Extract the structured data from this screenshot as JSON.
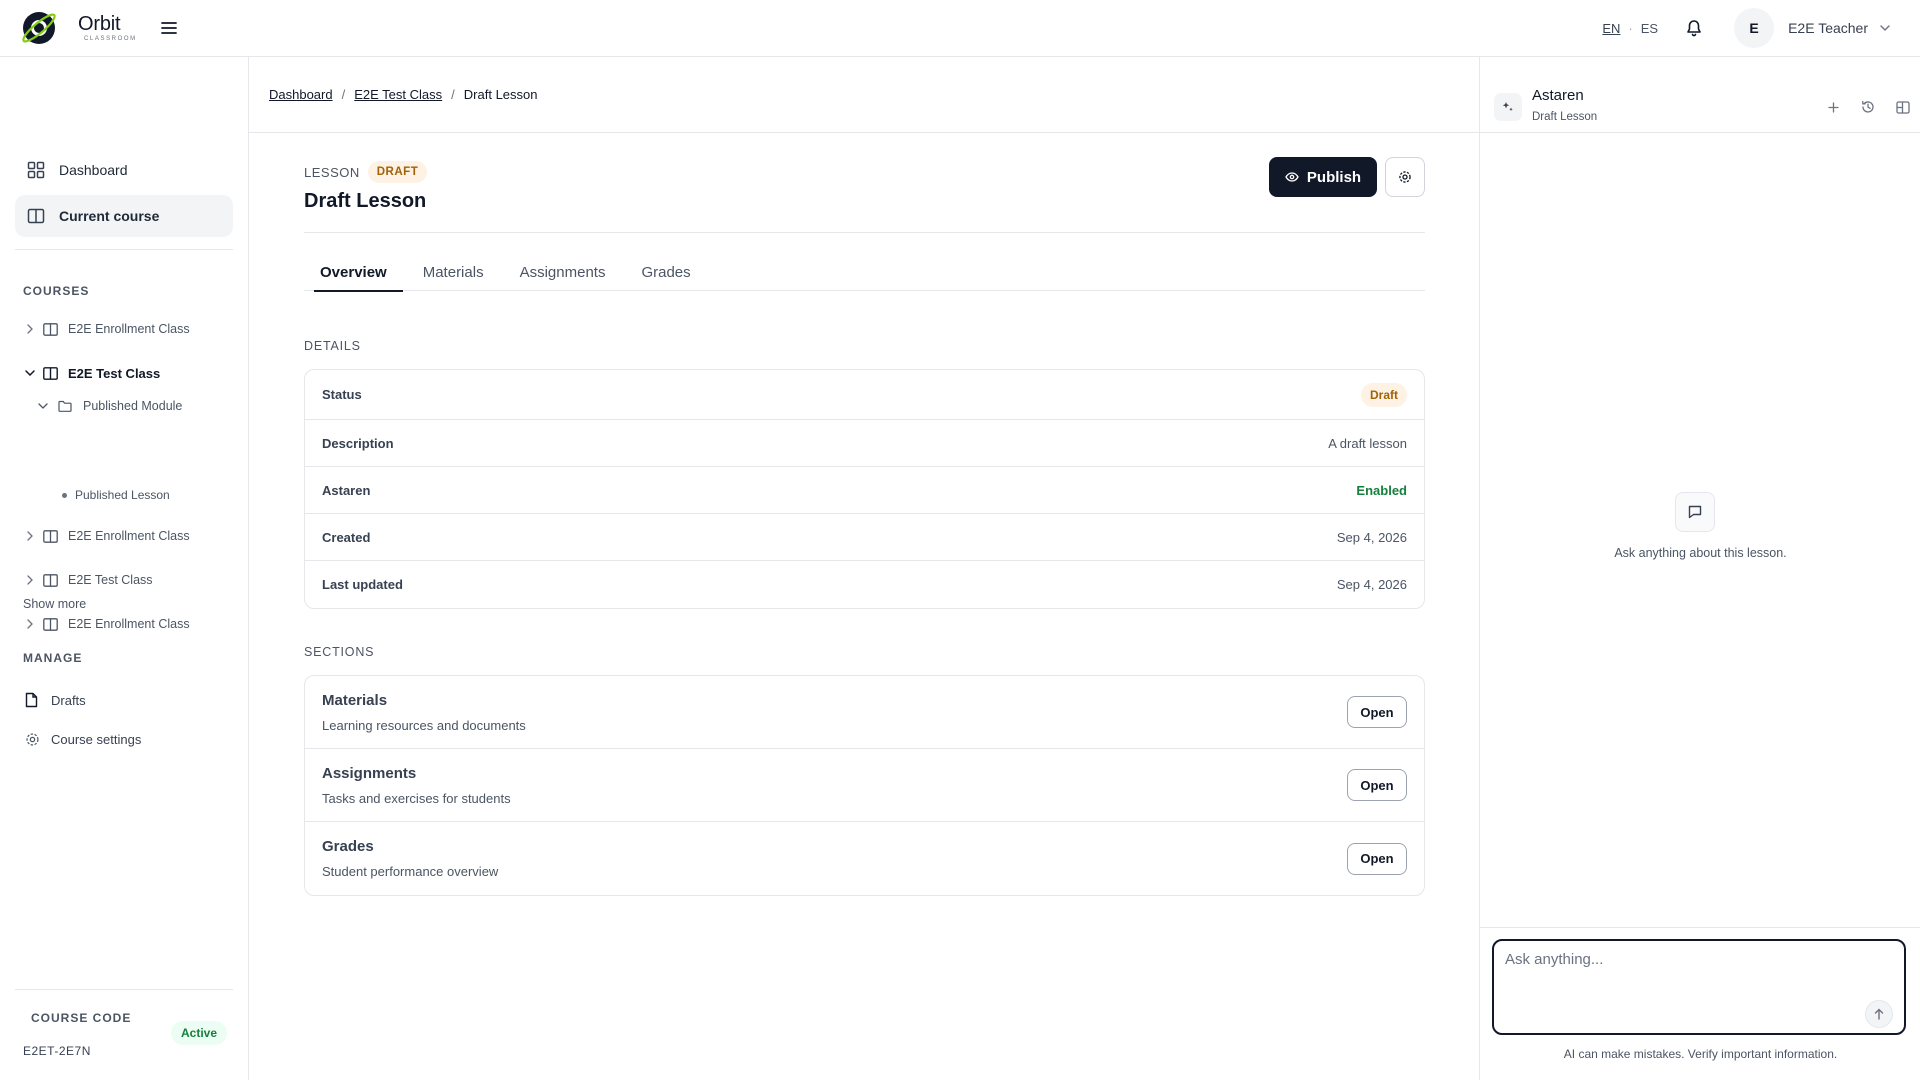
{
  "topbar": {
    "brand_name": "Orbit",
    "brand_sub": "CLASSROOM",
    "lang_active": "EN",
    "lang_sep": "·",
    "lang_other": "ES",
    "avatar_initial": "E",
    "user_name": "E2E Teacher"
  },
  "sidebar": {
    "nav": [
      {
        "label": "Dashboard"
      },
      {
        "label": "Current course"
      }
    ],
    "courses_label": "COURSES",
    "courses": [
      {
        "label": "E2E Enrollment Class"
      },
      {
        "label": "E2E Test Class"
      },
      {
        "label": "Published Module"
      },
      {
        "label": "Published Lesson"
      },
      {
        "label": "E2E Enrollment Class"
      },
      {
        "label": "E2E Test Class"
      },
      {
        "label": "E2E Enrollment Class"
      }
    ],
    "show_more": "Show more",
    "manage_label": "MANAGE",
    "manage": [
      {
        "label": "Drafts"
      },
      {
        "label": "Course settings"
      }
    ],
    "course_code_label": "COURSE CODE",
    "course_code": "E2ET-2E7N",
    "course_status": "Active"
  },
  "breadcrumb": [
    "Dashboard",
    "E2E Test Class",
    "Draft Lesson"
  ],
  "lesson": {
    "type_label": "LESSON",
    "state_badge": "DRAFT",
    "title": "Draft Lesson",
    "publish_label": "Publish"
  },
  "tabs": [
    "Overview",
    "Materials",
    "Assignments",
    "Grades"
  ],
  "details": {
    "heading": "DETAILS",
    "rows": [
      {
        "label": "Status",
        "value": "Draft"
      },
      {
        "label": "Description",
        "value": "A draft lesson"
      },
      {
        "label": "Astaren",
        "value": "Enabled"
      },
      {
        "label": "Created",
        "value": "Sep 4, 2026"
      },
      {
        "label": "Last updated",
        "value": "Sep 4, 2026"
      }
    ]
  },
  "sections": {
    "heading": "SECTIONS",
    "open_label": "Open",
    "rows": [
      {
        "title": "Materials",
        "desc": "Learning resources and documents"
      },
      {
        "title": "Assignments",
        "desc": "Tasks and exercises for students"
      },
      {
        "title": "Grades",
        "desc": "Student performance overview"
      }
    ]
  },
  "assistant": {
    "title": "Astaren",
    "subtitle": "Draft Lesson",
    "empty_text": "Ask anything about this lesson.",
    "placeholder": "Ask anything...",
    "disclaimer": "AI can make mistakes. Verify important information."
  },
  "colors": {
    "primary": "#111827",
    "draft_bg": "#fdf2e3",
    "draft_text": "#a16207",
    "success": "#15803d",
    "border": "#e5e7eb"
  }
}
